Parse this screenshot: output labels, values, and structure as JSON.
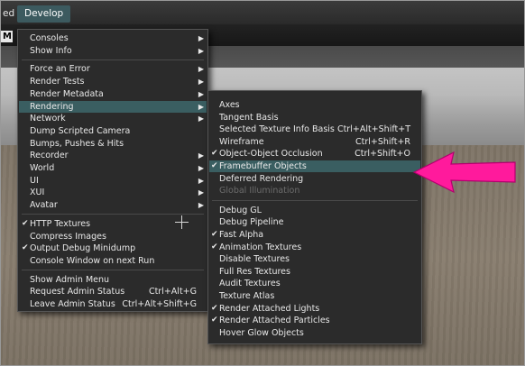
{
  "menubar": {
    "partial_label": "ed",
    "develop_label": "Develop"
  },
  "toolbar": {
    "badge": "M"
  },
  "develop_menu": {
    "items": [
      {
        "label": "Consoles",
        "arrow": true
      },
      {
        "label": "Show Info",
        "arrow": true
      },
      {
        "sep": true
      },
      {
        "label": "Force an Error",
        "arrow": true
      },
      {
        "label": "Render Tests",
        "arrow": true
      },
      {
        "label": "Render Metadata",
        "arrow": true
      },
      {
        "label": "Rendering",
        "arrow": true,
        "selected": true
      },
      {
        "label": "Network",
        "arrow": true
      },
      {
        "label": "Dump Scripted Camera"
      },
      {
        "label": "Bumps, Pushes & Hits"
      },
      {
        "label": "Recorder",
        "arrow": true
      },
      {
        "label": "World",
        "arrow": true
      },
      {
        "label": "UI",
        "arrow": true
      },
      {
        "label": "XUI",
        "arrow": true
      },
      {
        "label": "Avatar",
        "arrow": true
      },
      {
        "sep": true
      },
      {
        "label": "HTTP Textures",
        "checked": true
      },
      {
        "label": "Compress Images"
      },
      {
        "label": "Output Debug Minidump",
        "checked": true
      },
      {
        "label": "Console Window on next Run"
      },
      {
        "sep": true
      },
      {
        "label": "Show Admin Menu"
      },
      {
        "label": "Request Admin Status",
        "shortcut": "Ctrl+Alt+G"
      },
      {
        "label": "Leave Admin Status",
        "shortcut": "Ctrl+Alt+Shift+G"
      }
    ]
  },
  "rendering_menu": {
    "items": [
      {
        "label": "Axes"
      },
      {
        "label": "Tangent Basis"
      },
      {
        "label": "Selected Texture Info Basis",
        "shortcut": "Ctrl+Alt+Shift+T"
      },
      {
        "label": "Wireframe",
        "shortcut": "Ctrl+Shift+R"
      },
      {
        "label": "Object-Object Occlusion",
        "shortcut": "Ctrl+Shift+O",
        "checked": true
      },
      {
        "label": "Framebuffer Objects",
        "checked": true,
        "selected": true
      },
      {
        "label": "Deferred Rendering"
      },
      {
        "label": "Global Illumination",
        "disabled": true
      },
      {
        "sep": true
      },
      {
        "label": "Debug GL"
      },
      {
        "label": "Debug Pipeline"
      },
      {
        "label": "Fast Alpha",
        "checked": true
      },
      {
        "label": "Animation Textures",
        "checked": true
      },
      {
        "label": "Disable Textures"
      },
      {
        "label": "Full Res Textures"
      },
      {
        "label": "Audit Textures"
      },
      {
        "label": "Texture Atlas"
      },
      {
        "label": "Render Attached Lights",
        "checked": true
      },
      {
        "label": "Render Attached Particles",
        "checked": true
      },
      {
        "label": "Hover Glow Objects"
      }
    ]
  },
  "glyphs": {
    "check": "✔",
    "arrow": "▶"
  },
  "colors": {
    "highlight": "#3a5e61",
    "annotation_arrow": "#ff1a9c"
  }
}
